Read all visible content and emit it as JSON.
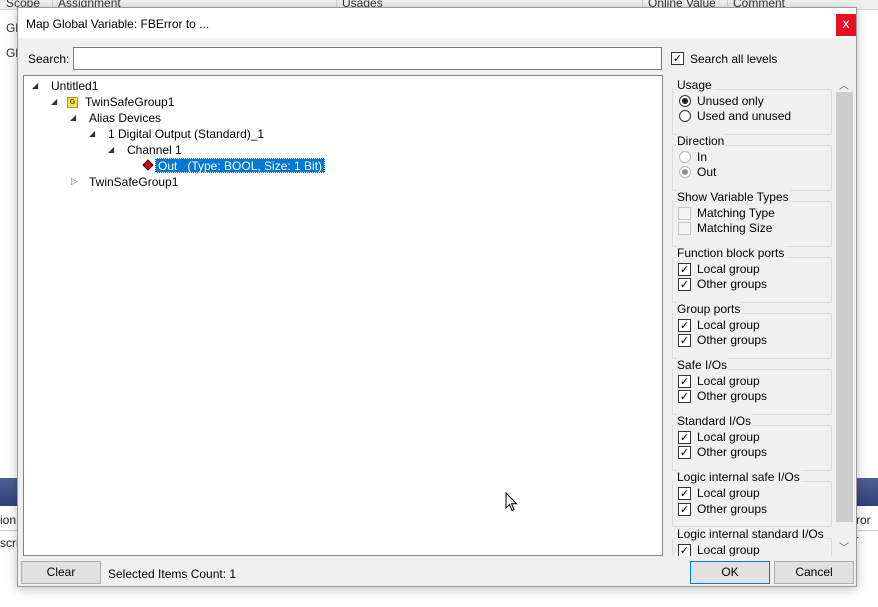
{
  "background": {
    "columns": [
      "Scope",
      "Assignment",
      "Usages",
      "Online Value",
      "Comment"
    ],
    "row_prefix": "Gl",
    "bottom_left_1": "ion",
    "bottom_left_2": "scri",
    "bottom_right": "rror L"
  },
  "dialog": {
    "title": "Map Global Variable: FBError to ...",
    "close_glyph": "x",
    "search_label": "Search:",
    "search_value": "",
    "search_all_label": "Search all levels",
    "search_all_checked": true
  },
  "tree": {
    "root": "Untitled1",
    "group1": "TwinSafeGroup1",
    "group_icon_text": "G",
    "alias": "Alias Devices",
    "device": "1 Digital Output (Standard)_1",
    "channel": "Channel 1",
    "selected_item": "Out   (Type: BOOL, Size: 1 Bit)",
    "group2": "TwinSafeGroup1"
  },
  "filters": {
    "usage": {
      "title": "Usage",
      "unused_only": "Unused only",
      "used_and_unused": "Used and unused",
      "selected": "Unused only"
    },
    "direction": {
      "title": "Direction",
      "in": "In",
      "out": "Out",
      "selected": "Out"
    },
    "variable_types": {
      "title": "Show Variable Types",
      "matching_type": "Matching Type",
      "matching_size": "Matching Size"
    },
    "function_block_ports": {
      "title": "Function block ports",
      "local": "Local group",
      "other": "Other groups"
    },
    "group_ports": {
      "title": "Group ports",
      "local": "Local group",
      "other": "Other groups"
    },
    "safe_ios": {
      "title": "Safe I/Os",
      "local": "Local group",
      "other": "Other groups"
    },
    "standard_ios": {
      "title": "Standard I/Os",
      "local": "Local group",
      "other": "Other groups"
    },
    "logic_internal_safe": {
      "title": "Logic internal safe I/Os",
      "local": "Local group",
      "other": "Other groups"
    },
    "logic_internal_standard": {
      "title": "Logic internal standard I/Os",
      "local": "Local group"
    }
  },
  "footer": {
    "clear_label": "Clear",
    "count_label": "Selected Items Count: 1",
    "ok_label": "OK",
    "cancel_label": "Cancel"
  },
  "colors": {
    "selection": "#0078d7",
    "close_button": "#e81123",
    "background_band": "#3a4d7f"
  }
}
